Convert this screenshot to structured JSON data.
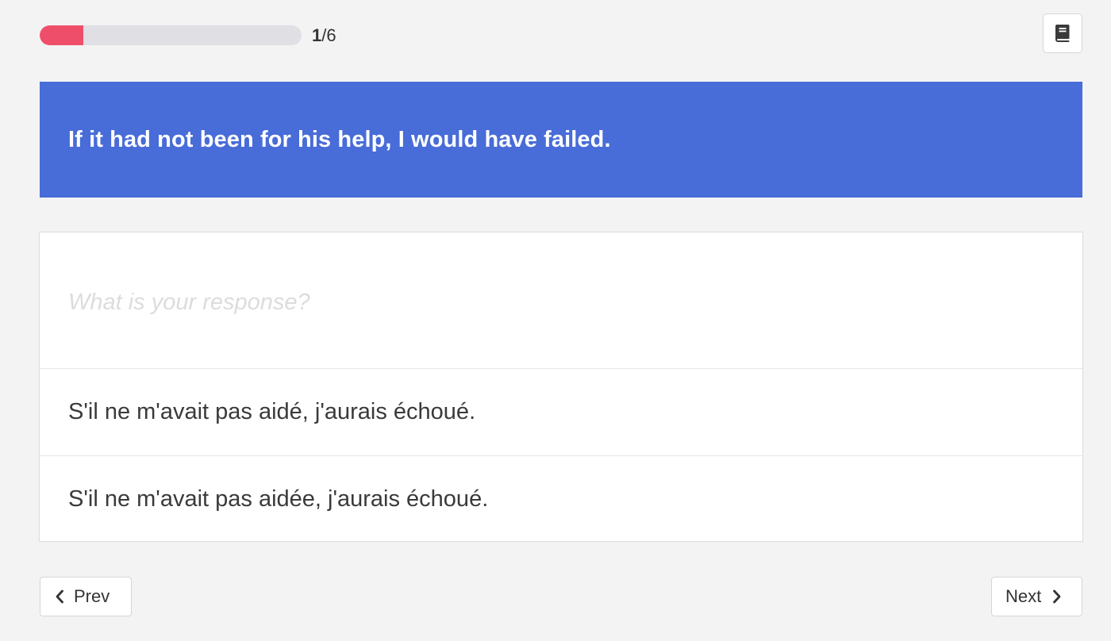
{
  "progress": {
    "current": "1",
    "total": "/6",
    "fraction": 0.1667,
    "fill_color": "#ee4e6a",
    "track_color": "#dfdfe4"
  },
  "toolbar": {
    "book_icon": "book-icon"
  },
  "prompt": {
    "text": "If it had not been for his help, I would have failed.",
    "background": "#486cd8"
  },
  "response": {
    "placeholder": "What is your response?",
    "value": ""
  },
  "options": [
    {
      "text": "S'il ne m'avait pas aidé, j'aurais échoué."
    },
    {
      "text": "S'il ne m'avait pas aidée, j'aurais échoué."
    }
  ],
  "navigation": {
    "prev_label": "Prev",
    "next_label": "Next",
    "prev_icon": "chevron-left-icon",
    "next_icon": "chevron-right-icon"
  }
}
